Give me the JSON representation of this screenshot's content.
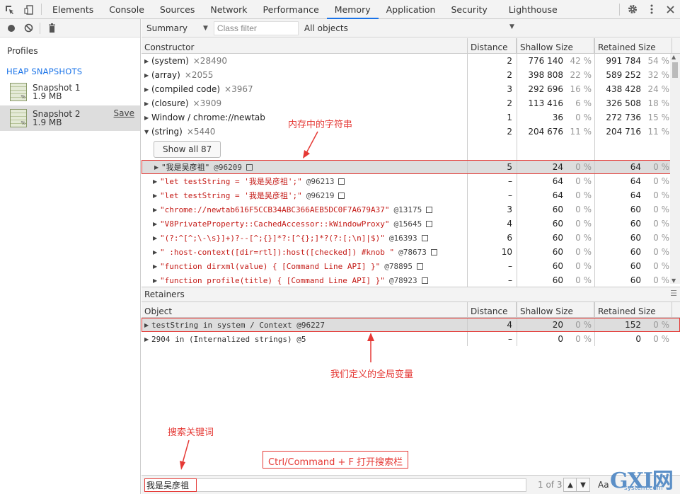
{
  "tabs": [
    {
      "label": "Elements"
    },
    {
      "label": "Console"
    },
    {
      "label": "Sources"
    },
    {
      "label": "Network"
    },
    {
      "label": "Performance"
    },
    {
      "label": "Memory"
    },
    {
      "label": "Application"
    },
    {
      "label": "Security"
    },
    {
      "label": "Lighthouse"
    }
  ],
  "accent_color": "#1a73e8",
  "annotation_color": "#e53935",
  "left": {
    "profiles_label": "Profiles",
    "heap_title": "HEAP SNAPSHOTS",
    "snapshots": [
      {
        "name": "Snapshot 1",
        "size": "1.9 MB"
      },
      {
        "name": "Snapshot 2",
        "size": "1.9 MB",
        "save": "Save"
      }
    ]
  },
  "toolbar": {
    "view": "Summary",
    "class_filter_placeholder": "Class filter",
    "scope": "All objects"
  },
  "main_table": {
    "headers": [
      "Constructor",
      "Distance",
      "Shallow Size",
      "Retained Size"
    ],
    "groups": [
      {
        "name": "(system)",
        "count": "×28490",
        "dist": "2",
        "shallow": "776 140",
        "shallow_pct": "42 %",
        "retained": "991 784",
        "retained_pct": "54 %"
      },
      {
        "name": "(array)",
        "count": "×2055",
        "dist": "2",
        "shallow": "398 808",
        "shallow_pct": "22 %",
        "retained": "589 252",
        "retained_pct": "32 %"
      },
      {
        "name": "(compiled code)",
        "count": "×3967",
        "dist": "3",
        "shallow": "292 696",
        "shallow_pct": "16 %",
        "retained": "438 428",
        "retained_pct": "24 %"
      },
      {
        "name": "(closure)",
        "count": "×3909",
        "dist": "2",
        "shallow": "113 416",
        "shallow_pct": "6 %",
        "retained": "326 508",
        "retained_pct": "18 %"
      },
      {
        "name": "Window / chrome://newtab",
        "count": "",
        "dist": "1",
        "shallow": "36",
        "shallow_pct": "0 %",
        "retained": "272 736",
        "retained_pct": "15 %"
      },
      {
        "name": "(string)",
        "count": "×5440",
        "dist": "2",
        "shallow": "204 676",
        "shallow_pct": "11 %",
        "retained": "204 716",
        "retained_pct": "11 %"
      }
    ],
    "show_all": "Show all 87",
    "children": [
      {
        "text": "\"我是吴彦祖\"",
        "id": "@96209",
        "dist": "5",
        "shallow": "24",
        "shallow_pct": "0 %",
        "retained": "64",
        "retained_pct": "0 %"
      },
      {
        "text": "\"let testString = '我是吴彦祖';\"",
        "id": "@96213",
        "dist": "–",
        "shallow": "64",
        "shallow_pct": "0 %",
        "retained": "64",
        "retained_pct": "0 %"
      },
      {
        "text": "\"let testString = '我是吴彦祖';\"",
        "id": "@96219",
        "dist": "–",
        "shallow": "64",
        "shallow_pct": "0 %",
        "retained": "64",
        "retained_pct": "0 %"
      },
      {
        "text": "\"chrome://newtab616F5CCB34ABC366AEB5DC0F7A679A37\"",
        "id": "@13175",
        "dist": "3",
        "shallow": "60",
        "shallow_pct": "0 %",
        "retained": "60",
        "retained_pct": "0 %"
      },
      {
        "text": "\"V8PrivateProperty::CachedAccessor::kWindowProxy\"",
        "id": "@15645",
        "dist": "4",
        "shallow": "60",
        "shallow_pct": "0 %",
        "retained": "60",
        "retained_pct": "0 %"
      },
      {
        "text": "\"(?:^[^;\\-\\s}]+)?--[^;{}]*?:[^{};]*?(?:[;\\n]|$)\"",
        "id": "@16393",
        "dist": "6",
        "shallow": "60",
        "shallow_pct": "0 %",
        "retained": "60",
        "retained_pct": "0 %"
      },
      {
        "text": "\" :host-context([dir=rtl]):host([checked]) #knob \"",
        "id": "@78673",
        "dist": "10",
        "shallow": "60",
        "shallow_pct": "0 %",
        "retained": "60",
        "retained_pct": "0 %"
      },
      {
        "text": "\"function dirxml(value) { [Command Line API] }\"",
        "id": "@78895",
        "dist": "–",
        "shallow": "60",
        "shallow_pct": "0 %",
        "retained": "60",
        "retained_pct": "0 %"
      },
      {
        "text": "\"function profile(title) { [Command Line API] }\"",
        "id": "@78923",
        "dist": "–",
        "shallow": "60",
        "shallow_pct": "0 %",
        "retained": "60",
        "retained_pct": "0 %"
      }
    ]
  },
  "retainers": {
    "title": "Retainers",
    "headers": [
      "Object",
      "Distance",
      "Shallow Size",
      "Retained Size"
    ],
    "rows": [
      {
        "text": "testString in system / Context @96227",
        "dist": "4",
        "shallow": "20",
        "shallow_pct": "0 %",
        "retained": "152",
        "retained_pct": "0 %"
      },
      {
        "text": "2904 in (Internalized strings) @5",
        "dist": "–",
        "shallow": "0",
        "shallow_pct": "0 %",
        "retained": "0",
        "retained_pct": "0 %"
      }
    ]
  },
  "annotations": {
    "string_in_memory": "内存中的字符串",
    "global_var": "我们定义的全局变量",
    "search_keyword": "搜索关键词",
    "shortcut": "Ctrl/Command + F 打开搜索栏"
  },
  "search": {
    "value": "我是吴彦祖",
    "count": "1 of 3",
    "match_case": "Aa"
  },
  "watermark": {
    "text": "GXI网",
    "sub": "system.com"
  }
}
